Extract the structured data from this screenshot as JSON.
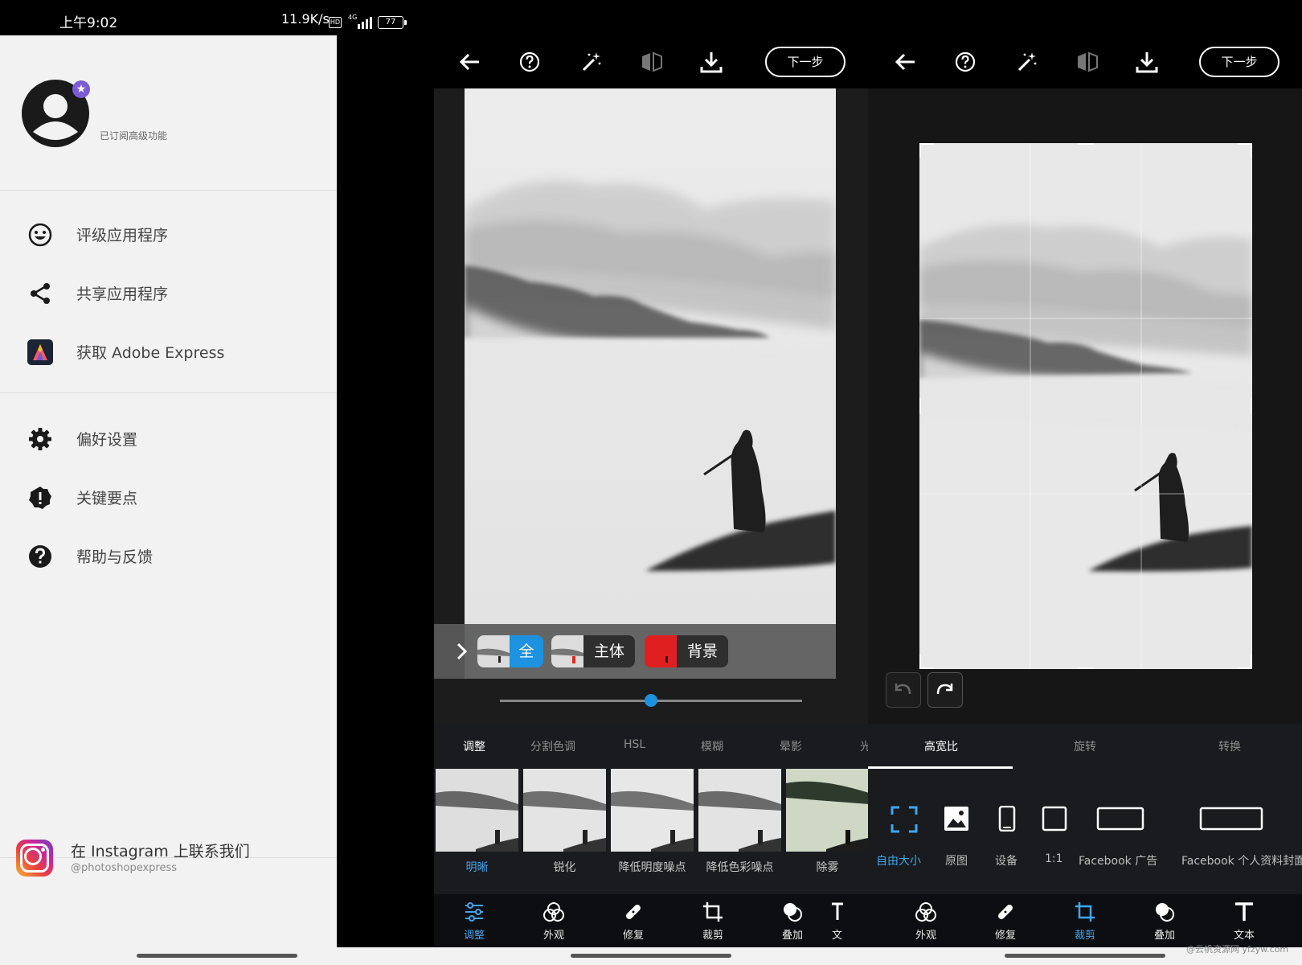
{
  "status_bar": {
    "time": "上午9:02",
    "network_speed": "11.9K/s",
    "hd": "HD",
    "signal": "4G",
    "battery": "77"
  },
  "drawer": {
    "subscription_text": "已订阅高级功能",
    "menu": [
      {
        "label": "评级应用程序",
        "icon": "smile-icon"
      },
      {
        "label": "共享应用程序",
        "icon": "share-icon"
      },
      {
        "label": "获取 Adobe Express",
        "icon": "adobe-express-icon"
      },
      {
        "label": "偏好设置",
        "icon": "gear-icon"
      },
      {
        "label": "关键要点",
        "icon": "alert-badge-icon"
      },
      {
        "label": "帮助与反馈",
        "icon": "help-icon"
      }
    ],
    "instagram": {
      "title": "在 Instagram 上联系我们",
      "handle": "@photoshopexpress"
    }
  },
  "editor_a": {
    "next_label": "下一步",
    "masks": [
      {
        "label": "全",
        "color": "#1c92e0"
      },
      {
        "label": "主体",
        "color": "#2e2e2e"
      },
      {
        "label": "背景",
        "color": "#2e2e2e"
      }
    ],
    "slider_value": 0.5,
    "tabs": [
      "调整",
      "分割色调",
      "HSL",
      "模糊",
      "晕影",
      "光"
    ],
    "active_tab": 0,
    "filters": [
      "明晰",
      "锐化",
      "降低明度噪点",
      "降低色彩噪点",
      "除雾"
    ],
    "active_filter": 0,
    "nav": [
      {
        "label": "调整",
        "icon": "sliders-icon"
      },
      {
        "label": "外观",
        "icon": "looks-icon"
      },
      {
        "label": "修复",
        "icon": "bandage-icon"
      },
      {
        "label": "裁剪",
        "icon": "crop-icon"
      },
      {
        "label": "叠加",
        "icon": "overlay-icon"
      },
      {
        "label": "文",
        "icon": "text-icon"
      }
    ],
    "active_nav": 0
  },
  "editor_b": {
    "next_label": "下一步",
    "tabs": [
      "高宽比",
      "旋转",
      "转换"
    ],
    "active_tab": 0,
    "aspects": [
      "自由大小",
      "原图",
      "设备",
      "1:1",
      "Facebook 广告",
      "Facebook 个人资料封面"
    ],
    "active_aspect": 0,
    "nav": [
      {
        "label": "外观",
        "icon": "looks-icon"
      },
      {
        "label": "修复",
        "icon": "bandage-icon"
      },
      {
        "label": "裁剪",
        "icon": "crop-icon"
      },
      {
        "label": "叠加",
        "icon": "overlay-icon"
      },
      {
        "label": "文本",
        "icon": "text-icon"
      }
    ],
    "active_nav": 2
  },
  "watermark": "@云帆资源网 yfzyw.com",
  "colors": {
    "accent": "#1c92e0",
    "premium": "#7b5cd6"
  }
}
